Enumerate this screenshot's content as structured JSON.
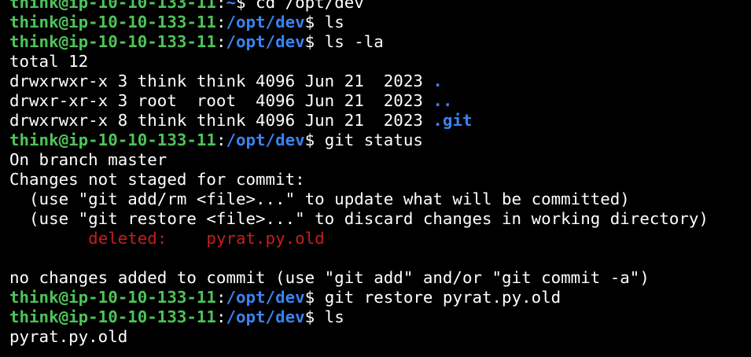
{
  "colors": {
    "background": "#000000",
    "foreground": "#ffffff",
    "prompt_user": "#4ec35a",
    "prompt_path": "#3a82f0",
    "directory": "#3a82f0",
    "deleted": "#c81e1e"
  },
  "prompt": {
    "user_host": "think@ip-10-10-133-11",
    "separator": ":",
    "home": "~",
    "dir": "/opt/dev",
    "dollar": "$ "
  },
  "lines": {
    "l1": {
      "cmd": "cd /opt/dev"
    },
    "l2": {
      "cmd": "ls"
    },
    "l3": {
      "cmd": "ls -la"
    },
    "l4": {
      "text": "total 12"
    },
    "l5": {
      "meta": "drwxrwxr-x 3 think think 4096 Jun 21  2023 ",
      "name": "."
    },
    "l6": {
      "meta": "drwxr-xr-x 3 root  root  4096 Jun 21  2023 ",
      "name": ".."
    },
    "l7": {
      "meta": "drwxrwxr-x 8 think think 4096 Jun 21  2023 ",
      "name": ".git"
    },
    "l8": {
      "cmd": "git status"
    },
    "l9": {
      "text": "On branch master"
    },
    "l10": {
      "text": "Changes not staged for commit:"
    },
    "l11": {
      "text": "  (use \"git add/rm <file>...\" to update what will be committed)"
    },
    "l12": {
      "text": "  (use \"git restore <file>...\" to discard changes in working directory)"
    },
    "l13": {
      "indent": "        ",
      "status": "deleted:    pyrat.py.old"
    },
    "l14": {
      "text": ""
    },
    "l15": {
      "text": "no changes added to commit (use \"git add\" and/or \"git commit -a\")"
    },
    "l16": {
      "cmd": "git restore pyrat.py.old"
    },
    "l17": {
      "cmd": "ls"
    },
    "l18": {
      "text": "pyrat.py.old"
    }
  }
}
